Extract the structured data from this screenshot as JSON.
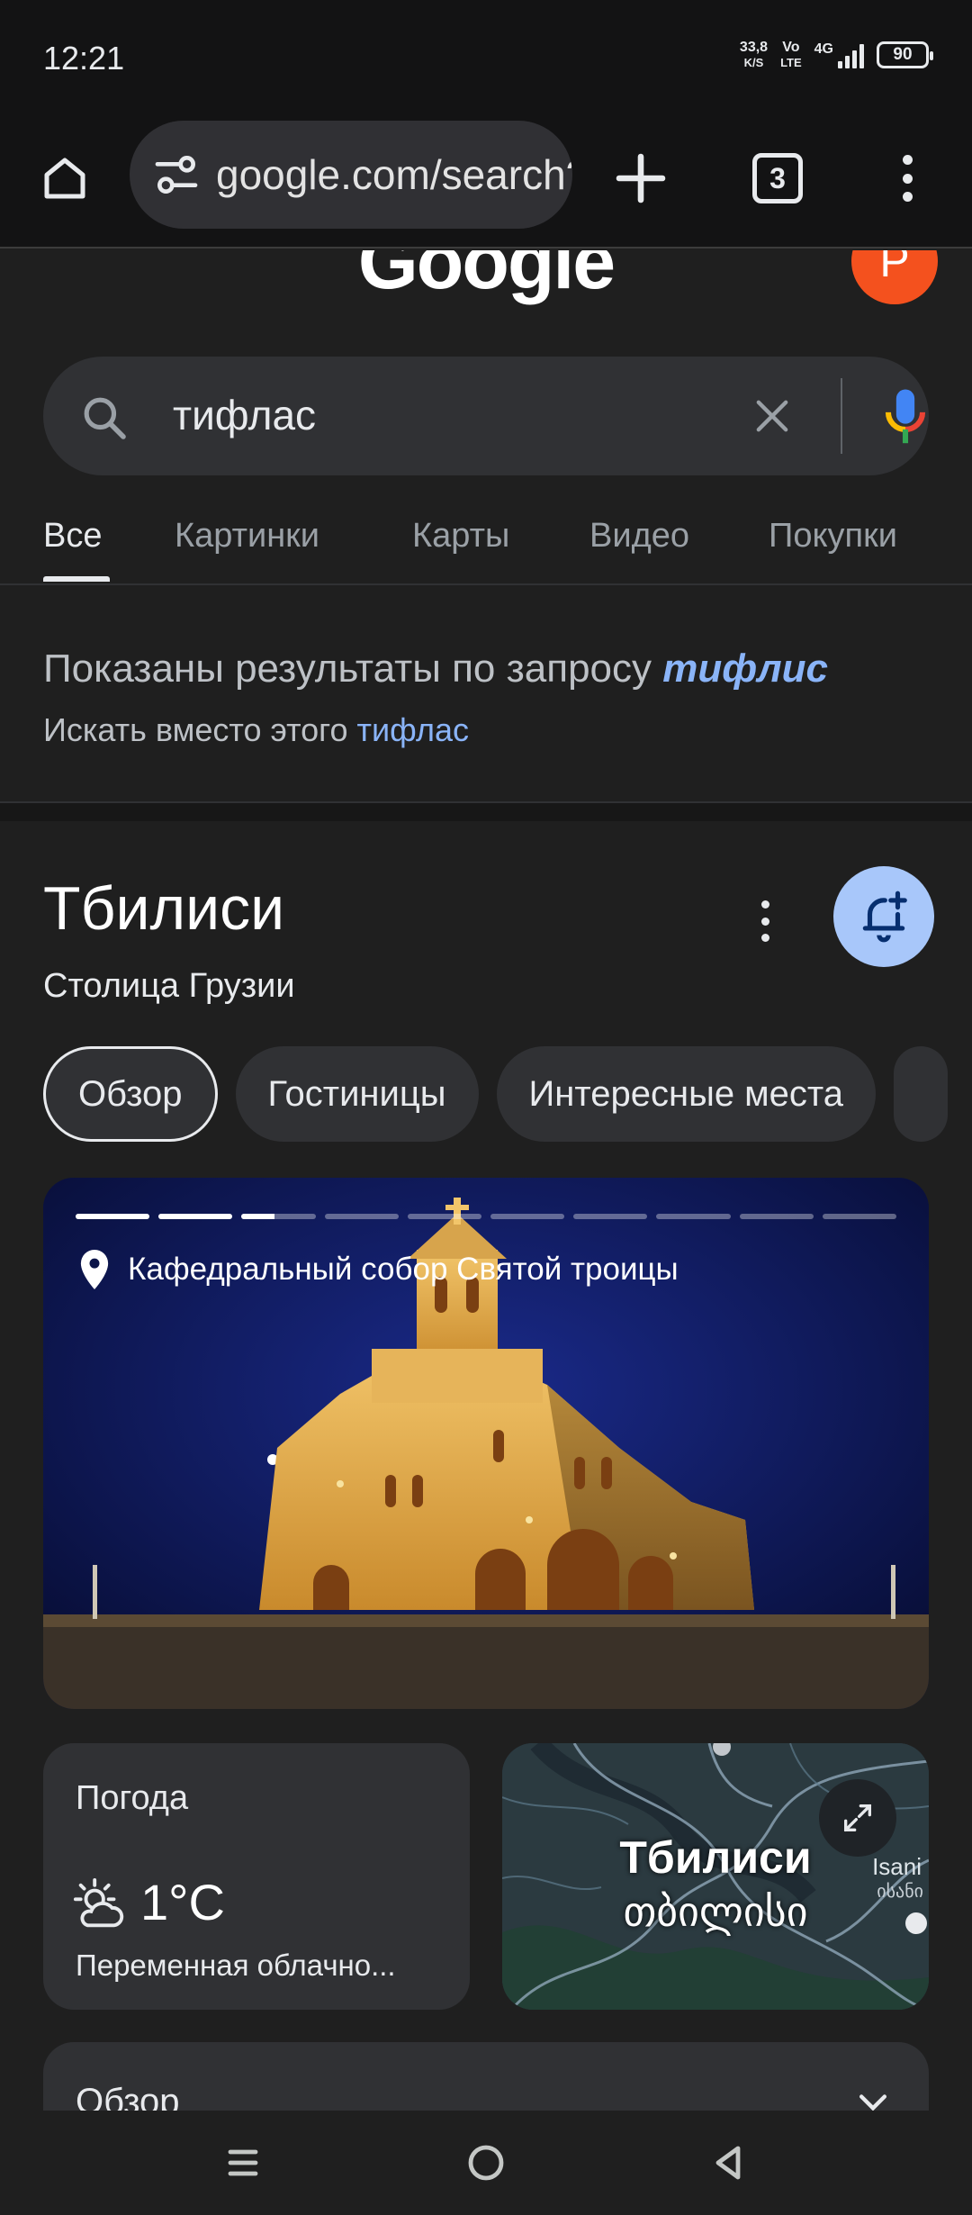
{
  "status_bar": {
    "time": "12:21",
    "speed_value": "33,8",
    "speed_unit": "K/S",
    "volte_top": "Vo",
    "volte_bottom": "LTE",
    "network": "4G",
    "battery": "90"
  },
  "toolbar": {
    "url": "google.com/search?q=тифлас",
    "tab_count": "3"
  },
  "page": {
    "logo": "Google",
    "avatar_letter": "P"
  },
  "search": {
    "query": "тифлас"
  },
  "tabs": [
    "Все",
    "Картинки",
    "Карты",
    "Видео",
    "Покупки"
  ],
  "spelling": {
    "showing_prefix": "Показаны результаты по запросу ",
    "corrected": "тифлис",
    "instead_prefix": "Искать вместо этого ",
    "original": "тифлас"
  },
  "knowledge_panel": {
    "title": "Тбилиси",
    "subtitle": "Столица Грузии",
    "chips": [
      "Обзор",
      "Гостиницы",
      "Интересные места"
    ],
    "photo": {
      "caption": "Кафедральный собор Святой троицы",
      "slide_progress": [
        1,
        1,
        0.45,
        0,
        0,
        0,
        0,
        0,
        0,
        0
      ]
    },
    "weather": {
      "title": "Погода",
      "temp": "1°C",
      "desc": "Переменная облачно..."
    },
    "map": {
      "title": "Тбилиси",
      "native_name": "თბილისი",
      "isani": "Isani",
      "isani_native": "ისანი"
    },
    "overview_label": "Обзор"
  },
  "colors": {
    "accent_link": "#8ab4f8",
    "bell_bg": "#a8c7fa",
    "avatar_bg": "#f4511e"
  }
}
